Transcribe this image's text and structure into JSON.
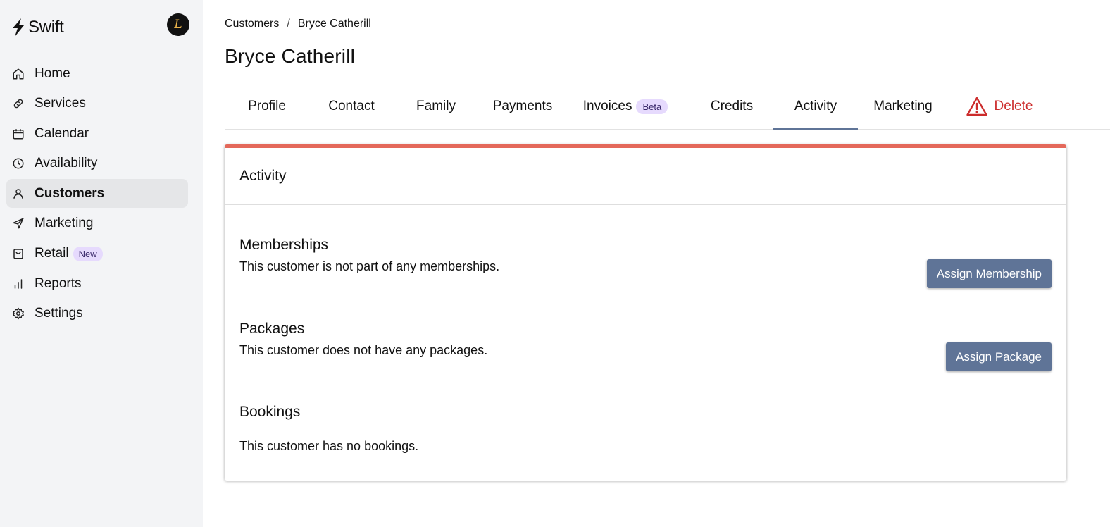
{
  "app": {
    "name": "Swift",
    "avatar_initial": "L"
  },
  "sidebar": {
    "items": [
      {
        "label": "Home",
        "icon": "home-icon"
      },
      {
        "label": "Services",
        "icon": "link-icon"
      },
      {
        "label": "Calendar",
        "icon": "calendar-icon"
      },
      {
        "label": "Availability",
        "icon": "clock-icon"
      },
      {
        "label": "Customers",
        "icon": "user-icon",
        "active": true
      },
      {
        "label": "Marketing",
        "icon": "send-icon"
      },
      {
        "label": "Retail",
        "icon": "shopping-bag-icon",
        "badge": "New"
      },
      {
        "label": "Reports",
        "icon": "bar-chart-icon"
      },
      {
        "label": "Settings",
        "icon": "gear-icon"
      }
    ]
  },
  "breadcrumb": {
    "parent": "Customers",
    "separator": "/",
    "current": "Bryce Catherill"
  },
  "page": {
    "title": "Bryce Catherill"
  },
  "tabs": [
    {
      "label": "Profile"
    },
    {
      "label": "Contact"
    },
    {
      "label": "Family"
    },
    {
      "label": "Payments"
    },
    {
      "label": "Invoices",
      "badge": "Beta"
    },
    {
      "label": "Credits"
    },
    {
      "label": "Activity",
      "active": true
    },
    {
      "label": "Marketing"
    },
    {
      "label": "Delete",
      "icon": "warning-icon",
      "color": "#cc2c2c"
    }
  ],
  "activity": {
    "title": "Activity",
    "memberships": {
      "heading": "Memberships",
      "message": "This customer is not part of any memberships.",
      "button": "Assign Membership"
    },
    "packages": {
      "heading": "Packages",
      "message": "This customer does not have any packages.",
      "button": "Assign Package"
    },
    "bookings": {
      "heading": "Bookings",
      "message": "This customer has no bookings."
    }
  },
  "colors": {
    "accent": "#5f7497",
    "card_top_border": "#e4685a",
    "danger": "#cc2c2c",
    "badge_bg": "#e6dafd",
    "sidebar_bg": "#f3f4f6"
  }
}
